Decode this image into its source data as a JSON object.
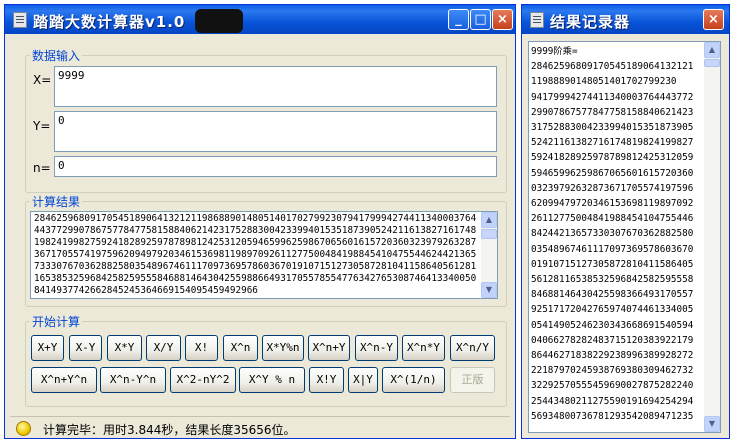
{
  "main_window": {
    "title": "踏踏大数计算器v1.0",
    "buttons": {
      "minimize": "_",
      "maximize": "□",
      "close": "×"
    }
  },
  "input_section": {
    "legend": "数据输入",
    "x_label": "X=",
    "x_value": "9999",
    "y_label": "Y=",
    "y_value": "0",
    "n_label": "n=",
    "n_value": "0"
  },
  "result_section": {
    "legend": "计算结果",
    "text": "2846259680917054518906413212119868890148051401702799230794179994274411340003764443772990786757784775815884062142317528830042339940153518739052421161382716174819824199827592418289259787898124253120594659962598670656016157203603239792632873671705574197596209497920346153698119897092611277500484198845410475544624421365733307670362882580354896746111709736957860367019107151273058728104115864056128116538532596842582595558468814643042559886649317055785547763427653087464133400508414937742662845245364669154095459492966"
  },
  "compute_section": {
    "legend": "开始计算",
    "row1": [
      "X+Y",
      "X-Y",
      "X*Y",
      "X/Y",
      "X!",
      "X^n",
      "X*Y%n",
      "X^n+Y",
      "X^n-Y",
      "X^n*Y",
      "X^n/Y"
    ],
    "row2": [
      "X^n+Y^n",
      "X^n-Y^n",
      "X^2-nY^2",
      "X^Y % n",
      "X!Y",
      "X|Y",
      "X^(1/n)",
      "正版"
    ]
  },
  "status": {
    "text": "计算完毕：用时3.844秒，结果长度35656位。"
  },
  "log_window": {
    "title": "结果记录器",
    "close": "×",
    "header_line": "9999阶乘=",
    "lines": [
      "28462596809170545189064132121",
      "11988890148051401702799230",
      "94179994274411340003764443772",
      "29907867577847758158840621423",
      "31752883004233994015351873905",
      "52421161382716174819824199827",
      "59241828925978789812425312059",
      "59465996259867065601615720360",
      "03239792632873671705574197596",
      "62099479720346153698119897092",
      "26112775004841988454104755446",
      "84244213657330307670362882580",
      "03548967461117097369578603670",
      "01910715127305872810411586405",
      "56128116538532596842582595558",
      "84688146430425598366493170557",
      "92517172042765974074461334005",
      "05414905246230343668691540594",
      "04066278282483715120383922179",
      "86446271838229238996389928272",
      "22187970245938769380309462732",
      "32292570555459690027875282240",
      "25443480211275590191694254294",
      "56934800736781293542089471235"
    ]
  }
}
